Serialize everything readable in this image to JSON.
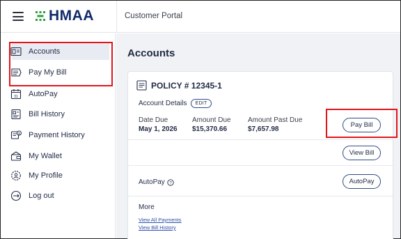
{
  "header": {
    "logo_text": "HMAA",
    "portal_title": "Customer Portal"
  },
  "sidebar": {
    "items": [
      {
        "label": "Accounts",
        "icon": "accounts-icon",
        "active": true
      },
      {
        "label": "Pay My Bill",
        "icon": "pay-bill-icon",
        "active": false
      },
      {
        "label": "AutoPay",
        "icon": "calendar-icon",
        "active": false
      },
      {
        "label": "Bill History",
        "icon": "bill-history-icon",
        "active": false
      },
      {
        "label": "Payment History",
        "icon": "payment-history-icon",
        "active": false
      },
      {
        "label": "My Wallet",
        "icon": "wallet-icon",
        "active": false
      },
      {
        "label": "My Profile",
        "icon": "profile-gear-icon",
        "active": false
      },
      {
        "label": "Log out",
        "icon": "logout-icon",
        "active": false
      }
    ]
  },
  "main": {
    "title": "Accounts",
    "policy": "POLICY # 12345-1",
    "account_details_label": "Account Details",
    "edit_label": "EDIT",
    "date_due_label": "Date Due",
    "date_due_value": "May 1, 2026",
    "amount_due_label": "Amount Due",
    "amount_due_value": "$15,370.66",
    "amount_past_due_label": "Amount Past Due",
    "amount_past_due_value": "$7,657.98",
    "pay_bill_label": "Pay Bill",
    "view_bill_label": "View Bill",
    "autopay_label": "AutoPay",
    "autopay_button_label": "AutoPay",
    "more_label": "More",
    "links": [
      "View All Payments",
      "View Bill History"
    ]
  },
  "colors": {
    "brand_navy": "#0f2a6b",
    "brand_green": "#2e9e3f",
    "highlight_red": "#e0141a",
    "active_bg": "#e8ebf2"
  }
}
